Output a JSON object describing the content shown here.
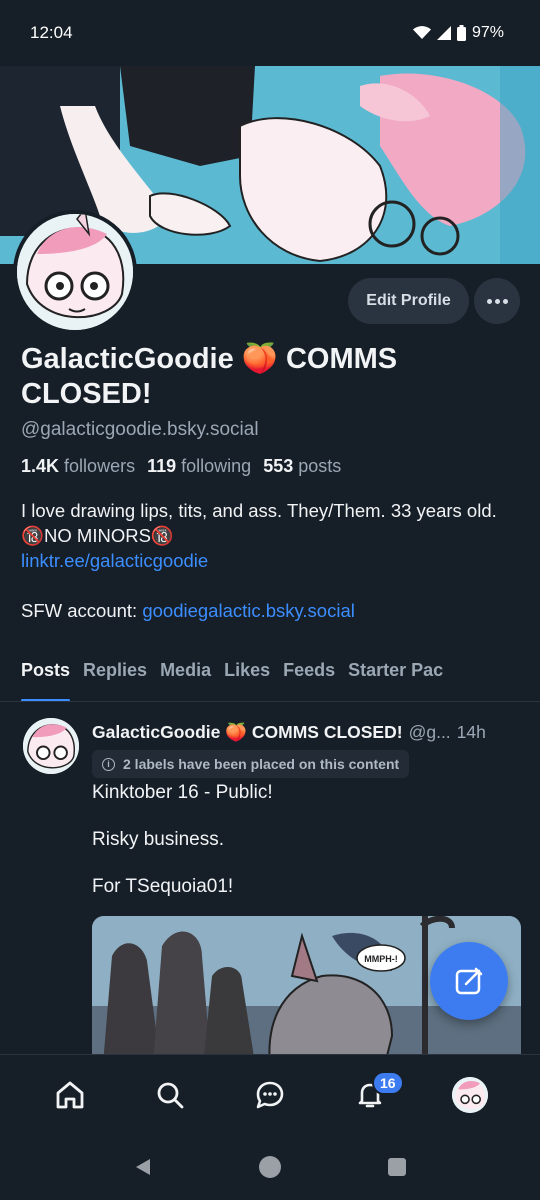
{
  "status_bar": {
    "time": "12:04",
    "battery": "97%"
  },
  "profile": {
    "edit_label": "Edit Profile",
    "display_name": "GalacticGoodie 🍑 COMMS CLOSED!",
    "handle": "@galacticgoodie.bsky.social",
    "followers_count": "1.4K",
    "followers_label": "followers",
    "following_count": "119",
    "following_label": "following",
    "posts_count": "553",
    "posts_label": "posts",
    "bio_line1": "I love drawing lips, tits, and ass. They/Them. 33 years old. 🔞NO MINORS🔞",
    "bio_link": "linktr.ee/galacticgoodie",
    "sfw_prefix": "SFW account: ",
    "sfw_link": "goodiegalactic.bsky.social"
  },
  "tabs": [
    "Posts",
    "Replies",
    "Media",
    "Likes",
    "Feeds",
    "Starter Pac"
  ],
  "post": {
    "author": "GalacticGoodie 🍑 COMMS CLOSED!",
    "handle": "@g...",
    "time": "14h",
    "label_notice": "2 labels have been placed on this content",
    "text_line1": "Kinktober 16 - Public!",
    "text_line2": "Risky business.",
    "text_line3": "For TSequoia01!",
    "image_caption": "MMPH-!"
  },
  "nav": {
    "notifications_badge": "16"
  },
  "colors": {
    "background": "#161e27",
    "accent": "#3c8eff",
    "button_bg": "#2a3441"
  }
}
